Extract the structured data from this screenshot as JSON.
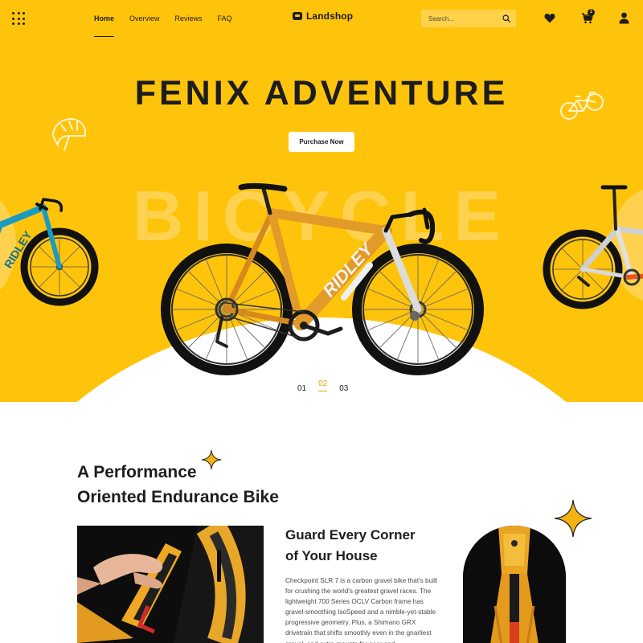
{
  "nav": {
    "links": [
      "Home",
      "Overview",
      "Reviews",
      "FAQ"
    ],
    "active_link": "Home",
    "brand": "Landshop",
    "search_placeholder": "Search...",
    "cart_count": "2"
  },
  "hero": {
    "title": "FENIX ADVENTURE",
    "cta": "Purchase Now",
    "background_word": "BICYCLE",
    "slides": [
      "01",
      "02",
      "03"
    ],
    "active_slide": "02",
    "bike_brand_text": "RIDLEY"
  },
  "feature": {
    "title_line1": "A Performance",
    "title_line2": "Oriented Endurance Bike",
    "subtitle_line1": "Guard Every Corner",
    "subtitle_line2": "of Your House",
    "body": "Checkpoint SLR 7 is a carbon gravel bike that's built for crushing the world's greatest gravel races. The lightweight 700 Series OCLV Carbon frame has gravel-smoothing IsoSpeed and a nimble-yet-stable progressive geometry. Plus, a Shimano GRX drivetrain that shifts smoothly even in the gnarliest gravel, and extra mounts for gear and"
  },
  "colors": {
    "brand_yellow": "#fec40b",
    "text_dark": "#1d1d1d",
    "accent_orange": "#e5a800"
  },
  "icons": [
    "grid-menu-icon",
    "brand-logo-icon",
    "search-icon",
    "heart-icon",
    "cart-icon",
    "user-icon",
    "helmet-icon",
    "bicycle-outline-icon",
    "sparkle-icon"
  ]
}
